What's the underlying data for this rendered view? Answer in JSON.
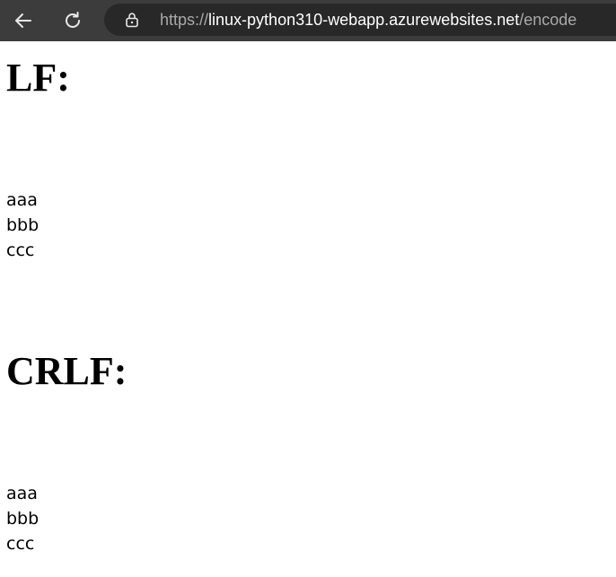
{
  "browser": {
    "url_scheme": "https://",
    "url_host": "linux-python310-webapp.azurewebsites.net",
    "url_path": "/encode",
    "icons": {
      "back": "back-arrow-icon",
      "reload": "reload-icon",
      "lock": "lock-icon"
    }
  },
  "page": {
    "lf": {
      "heading": "LF:",
      "lines": [
        "aaa",
        "bbb",
        "ccc"
      ]
    },
    "crlf": {
      "heading": "CRLF:",
      "lines": [
        "aaa",
        "bbb",
        "ccc"
      ]
    }
  },
  "colors": {
    "toolbar": "#3c3c3c",
    "address_bar": "#282828",
    "url_dim": "#a9a9a9",
    "url_host": "#ffffff"
  }
}
